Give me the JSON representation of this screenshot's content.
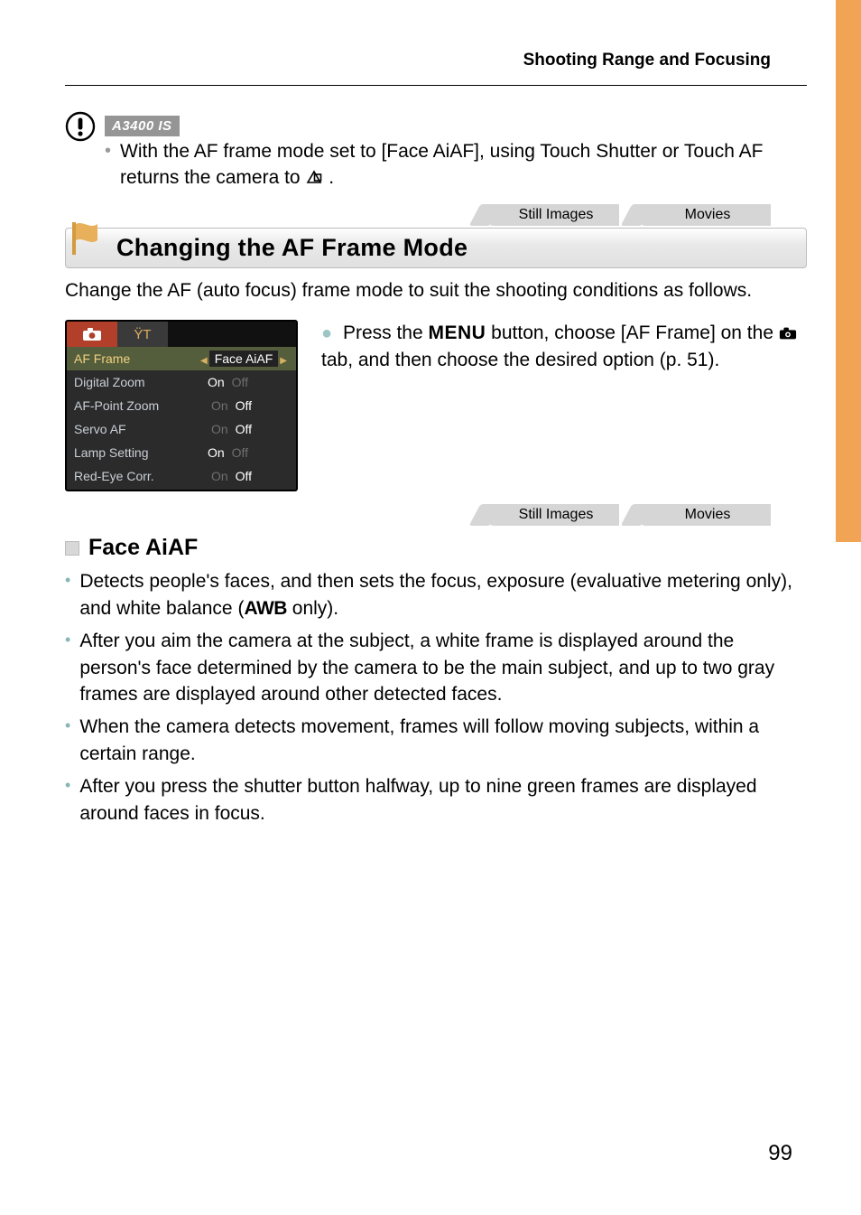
{
  "header": {
    "section_title": "Shooting Range and Focusing"
  },
  "notice": {
    "model_badge": "A3400 IS",
    "text_before_icon": "With the AF frame mode set to [Face AiAF], using Touch Shutter or Touch AF returns the camera to ",
    "text_after_icon": "."
  },
  "tags": {
    "still": "Still Images",
    "movies": "Movies"
  },
  "section": {
    "title": "Changing the AF Frame Mode",
    "intro": "Change the AF (auto focus) frame mode to suit the shooting conditions as follows."
  },
  "lcd": {
    "tools_glyph": "ŸT",
    "rows": [
      {
        "label": "AF Frame",
        "left_tri": "◀",
        "value": "Face AiAF",
        "right_tri": "▶",
        "selected": true
      },
      {
        "label": "Digital Zoom",
        "on": "On",
        "dim": "Off"
      },
      {
        "label": "AF-Point Zoom",
        "dim": "On",
        "off": "Off"
      },
      {
        "label": "Servo AF",
        "dim": "On",
        "off": "Off"
      },
      {
        "label": "Lamp Setting",
        "on": "On",
        "dim": "Off"
      },
      {
        "label": "Red-Eye Corr.",
        "dim": "On",
        "off": "Off"
      }
    ]
  },
  "step": {
    "before_menu": "Press the ",
    "menu_word": "MENU",
    "between": " button, choose [AF Frame] on the ",
    "after": " tab, and then choose the desired option (p. 51)."
  },
  "subsection": {
    "title": "Face AiAF",
    "bullets": [
      {
        "pre": "Detects people's faces, and then sets the focus, exposure (evaluative metering only), and white balance (",
        "awb": "AWB",
        "post": " only)."
      },
      {
        "text": "After you aim the camera at the subject, a white frame is displayed around the person's face determined by the camera to be the main subject, and up to two gray frames are displayed around other detected faces."
      },
      {
        "text": "When the camera detects movement, frames will follow moving subjects, within a certain range."
      },
      {
        "text": "After you press the shutter button halfway, up to nine green frames are displayed around faces in focus."
      }
    ]
  },
  "page_number": "99"
}
